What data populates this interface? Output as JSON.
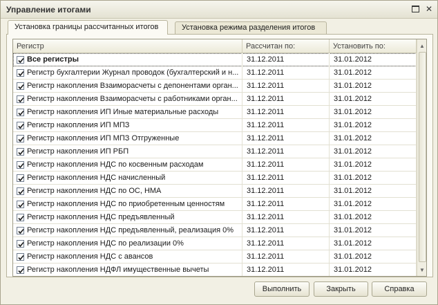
{
  "window": {
    "title": "Управление итогами",
    "maximize_icon": "maximize-icon",
    "close_icon": "close-icon",
    "close_glyph": "✕"
  },
  "tabs": [
    {
      "label": "Установка границы рассчитанных итогов",
      "active": true
    },
    {
      "label": "Установка режима разделения итогов",
      "active": false
    }
  ],
  "table": {
    "columns": [
      "Регистр",
      "Рассчитан по:",
      "Установить по:"
    ],
    "rows": [
      {
        "checked": true,
        "name": "Все регистры",
        "calculated": "31.12.2011",
        "set_to": "31.01.2012",
        "bold": true
      },
      {
        "checked": true,
        "name": "Регистр бухгалтерии Журнал проводок (бухгалтерский и н...",
        "calculated": "31.12.2011",
        "set_to": "31.01.2012"
      },
      {
        "checked": true,
        "name": "Регистр накопления Взаиморасчеты с депонентами орган...",
        "calculated": "31.12.2011",
        "set_to": "31.01.2012"
      },
      {
        "checked": true,
        "name": "Регистр накопления Взаиморасчеты с работниками орган...",
        "calculated": "31.12.2011",
        "set_to": "31.01.2012"
      },
      {
        "checked": true,
        "name": "Регистр накопления ИП Иные материальные расходы",
        "calculated": "31.12.2011",
        "set_to": "31.01.2012"
      },
      {
        "checked": true,
        "name": "Регистр накопления ИП МПЗ",
        "calculated": "31.12.2011",
        "set_to": "31.01.2012"
      },
      {
        "checked": true,
        "name": "Регистр накопления ИП МПЗ Отгруженные",
        "calculated": "31.12.2011",
        "set_to": "31.01.2012"
      },
      {
        "checked": true,
        "name": "Регистр накопления ИП РБП",
        "calculated": "31.12.2011",
        "set_to": "31.01.2012"
      },
      {
        "checked": true,
        "name": "Регистр накопления НДС по косвенным расходам",
        "calculated": "31.12.2011",
        "set_to": "31.01.2012"
      },
      {
        "checked": true,
        "name": "Регистр накопления НДС начисленный",
        "calculated": "31.12.2011",
        "set_to": "31.01.2012"
      },
      {
        "checked": true,
        "name": "Регистр накопления НДС по ОС, НМА",
        "calculated": "31.12.2011",
        "set_to": "31.01.2012"
      },
      {
        "checked": true,
        "name": "Регистр накопления НДС по приобретенным ценностям",
        "calculated": "31.12.2011",
        "set_to": "31.01.2012"
      },
      {
        "checked": true,
        "name": "Регистр накопления НДС предъявленный",
        "calculated": "31.12.2011",
        "set_to": "31.01.2012"
      },
      {
        "checked": true,
        "name": "Регистр накопления НДС предъявленный, реализация 0%",
        "calculated": "31.12.2011",
        "set_to": "31.01.2012"
      },
      {
        "checked": true,
        "name": "Регистр накопления НДС по реализации 0%",
        "calculated": "31.12.2011",
        "set_to": "31.01.2012"
      },
      {
        "checked": true,
        "name": "Регистр накопления НДС с авансов",
        "calculated": "31.12.2011",
        "set_to": "31.01.2012"
      },
      {
        "checked": true,
        "name": "Регистр накопления НДФЛ имущественные вычеты",
        "calculated": "31.12.2011",
        "set_to": "31.01.2012"
      }
    ]
  },
  "scrollbar": {
    "up_icon": "scroll-up-arrow-icon",
    "down_icon": "scroll-down-arrow-icon",
    "up_glyph": "▲",
    "down_glyph": "▼"
  },
  "buttons": {
    "run": "Выполнить",
    "close": "Закрыть",
    "help": "Справка"
  }
}
